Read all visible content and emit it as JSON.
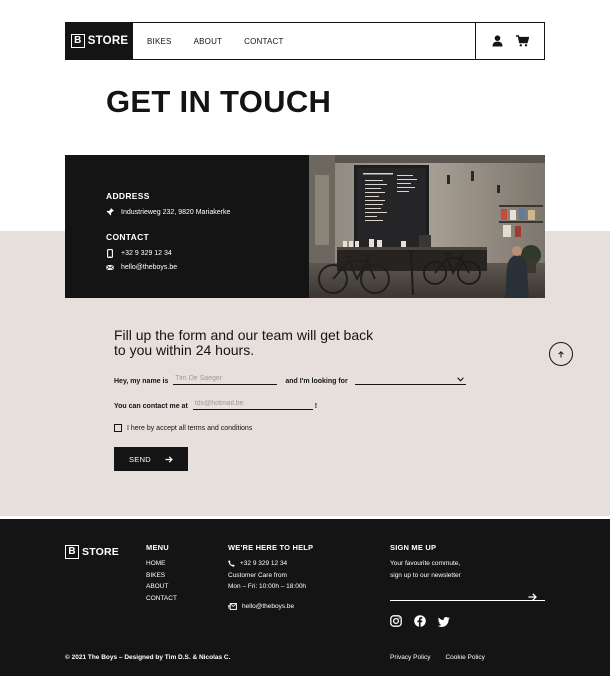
{
  "nav": {
    "logo_letter": "B",
    "logo_text": "STORE",
    "links": [
      "BIKES",
      "ABOUT",
      "CONTACT"
    ],
    "icons": [
      "user-icon",
      "cart-icon"
    ]
  },
  "page_title": "GET IN TOUCH",
  "info": {
    "address_heading": "ADDRESS",
    "address": "Industrieweg 232, 9820 Mariakerke",
    "contact_heading": "CONTACT",
    "phone": "+32 9 329 12 34",
    "email": "hello@theboys.be"
  },
  "form": {
    "title": "Fill up the form and our team will get back to you within 24 hours.",
    "name_label": "Hey, my name is",
    "name_placeholder": "Tim De Saeger",
    "looking_label": "and I'm looking for",
    "contact_label": "You can contact me at",
    "email_placeholder": "tds@hotmail.be",
    "exclamation": "!",
    "terms_label": "I here by accept all terms and conditions",
    "send_label": "SEND"
  },
  "footer": {
    "logo_letter": "B",
    "logo_text": "STORE",
    "menu_title": "MENU",
    "menu_items": [
      "HOME",
      "BIKES",
      "ABOUT",
      "CONTACT"
    ],
    "help_title": "WE'RE HERE TO HELP",
    "help_phone": "+32 9 329 12 34",
    "help_care": "Customer Care from",
    "help_hours": "Mon – Fri: 10:00h – 18:00h",
    "help_email": "hello@theboys.be",
    "signup_title": "SIGN ME UP",
    "signup_text_1": "Your favourite commute,",
    "signup_text_2": "sign up to our newsletter",
    "copyright": "© 2021 The Boys – Designed by Tim D.S. & Nicolas C.",
    "privacy": "Privacy Policy",
    "cookie": "Cookie Policy"
  },
  "colors": {
    "dark": "#141414",
    "beige": "#e7dfdb",
    "white": "#ffffff"
  }
}
